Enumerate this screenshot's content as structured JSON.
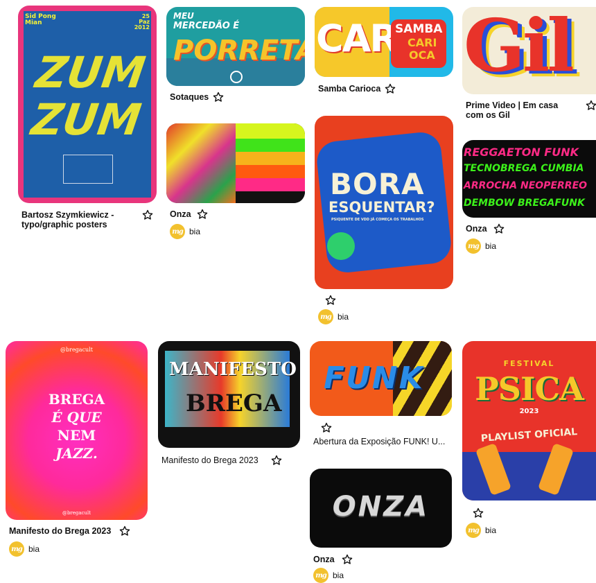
{
  "pins": [
    {
      "id": "zum",
      "title": "Bartosz Szymkiewicz - typo/graphic posters",
      "author": null,
      "art": {
        "top_left": "Sid Pong\nMian",
        "top_right": "25\nPaz\n2012",
        "line1": "ZUM",
        "line2": "ZUM"
      }
    },
    {
      "id": "porreta",
      "title": "Sotaques",
      "author": null,
      "art": {
        "line1": "MEU",
        "line2": "MERCEDÃO É",
        "line3": "PORRETA"
      }
    },
    {
      "id": "onza-neon",
      "title": "Onza",
      "author": "bia"
    },
    {
      "id": "samba",
      "title": "Samba Carioca",
      "author": null,
      "art": {
        "left": "CAR",
        "badge1": "SAMBA",
        "badge2": "CARI",
        "badge3": "OCA"
      }
    },
    {
      "id": "bora",
      "title": "",
      "author": "bia",
      "art": {
        "line1": "BORA",
        "line2": "ESQUENTAR?",
        "sub": "PSIQUENTE DE VDD JÁ COMEÇA OS TRABALHOS"
      }
    },
    {
      "id": "gil",
      "title": "Prime Video | Em casa com os Gil",
      "author": null,
      "art": {
        "word": "Gil"
      }
    },
    {
      "id": "reggaeton",
      "title": "Onza",
      "author": "bia",
      "art": {
        "rows": [
          "REGGAETON FUNK",
          "TECNOBREGA CUMBIA",
          "ARROCHA NEOPERREO",
          "DEMBOW BREGAFUNK"
        ]
      }
    },
    {
      "id": "jazz",
      "title": "Manifesto do Brega 2023",
      "author": "bia",
      "art": {
        "top": "@bregacult",
        "lines": [
          "BREGA",
          "É QUE",
          "NEM",
          "JAZZ."
        ],
        "bottom": "@bregacult"
      }
    },
    {
      "id": "manifesto",
      "title": "Manifesto do Brega 2023",
      "author": null,
      "art": {
        "line1": "MANIFESTO",
        "line2": "BREGA"
      }
    },
    {
      "id": "funk",
      "title": "Abertura da Exposição FUNK! U...",
      "author": null,
      "art": {
        "word": "FUNK"
      }
    },
    {
      "id": "onza-logo",
      "title": "Onza",
      "author": "bia",
      "art": {
        "word": "ONZA"
      }
    },
    {
      "id": "psica",
      "title": "",
      "author": "bia",
      "art": {
        "fest": "FESTIVAL",
        "word": "PSICA",
        "year": "2023",
        "sub": "PLAYLIST OFICIAL"
      }
    }
  ],
  "avatar_initials": "mg",
  "colors": {
    "page": "#ffffff",
    "text": "#111111",
    "avatar": "#f2c12e"
  }
}
